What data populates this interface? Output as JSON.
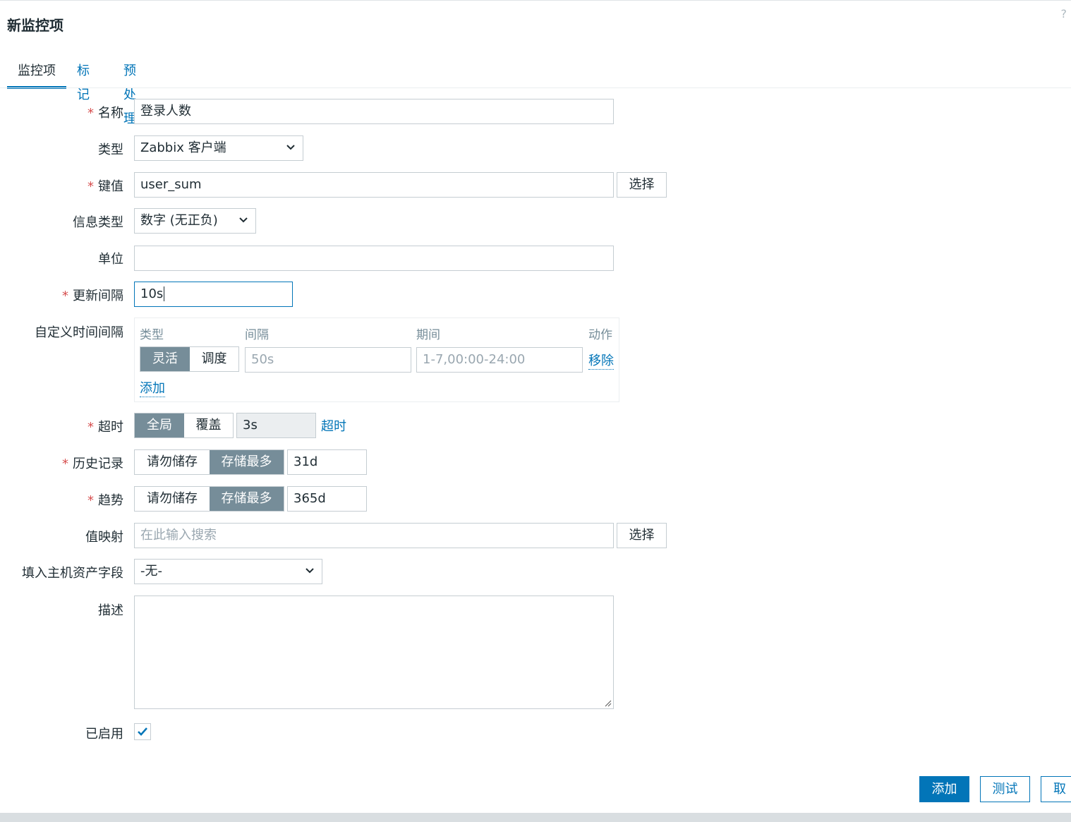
{
  "dialog": {
    "title": "新监控项",
    "help": "?"
  },
  "tabs": [
    {
      "label": "监控项",
      "active": true
    },
    {
      "label": "标记",
      "active": false
    },
    {
      "label": "预处理",
      "active": false
    }
  ],
  "form": {
    "name": {
      "label": "名称",
      "value": "登录人数",
      "required": true
    },
    "type": {
      "label": "类型",
      "value": "Zabbix 客户端"
    },
    "key": {
      "label": "键值",
      "value": "user_sum",
      "select_label": "选择",
      "required": true
    },
    "info_type": {
      "label": "信息类型",
      "value": "数字 (无正负)"
    },
    "units": {
      "label": "单位",
      "value": ""
    },
    "update_interval": {
      "label": "更新间隔",
      "value": "10s",
      "required": true
    },
    "custom_intervals": {
      "label": "自定义时间间隔",
      "headers": {
        "type": "类型",
        "interval": "间隔",
        "period": "期间",
        "action": "动作"
      },
      "row": {
        "options": [
          "灵活",
          "调度"
        ],
        "selected": "灵活",
        "interval": "50s",
        "period": "1-7,00:00-24:00",
        "remove": "移除"
      },
      "add": "添加"
    },
    "timeout": {
      "label": "超时",
      "options": [
        "全局",
        "覆盖"
      ],
      "selected": "全局",
      "value": "3s",
      "link": "超时",
      "required": true
    },
    "history": {
      "label": "历史记录",
      "options": [
        "请勿储存",
        "存储最多"
      ],
      "selected": "存储最多",
      "value": "31d",
      "required": true
    },
    "trends": {
      "label": "趋势",
      "options": [
        "请勿储存",
        "存储最多"
      ],
      "selected": "存储最多",
      "value": "365d",
      "required": true
    },
    "valuemap": {
      "label": "值映射",
      "placeholder": "在此输入搜索",
      "select_label": "选择"
    },
    "inventory": {
      "label": "填入主机资产字段",
      "value": "-无-"
    },
    "description": {
      "label": "描述",
      "value": ""
    },
    "enabled": {
      "label": "已启用",
      "checked": true
    }
  },
  "footer": {
    "add": "添加",
    "test": "测试",
    "cancel": "取消"
  },
  "colors": {
    "primary": "#0275b8",
    "toggle_active": "#768d99",
    "required": "#d64e4e"
  }
}
